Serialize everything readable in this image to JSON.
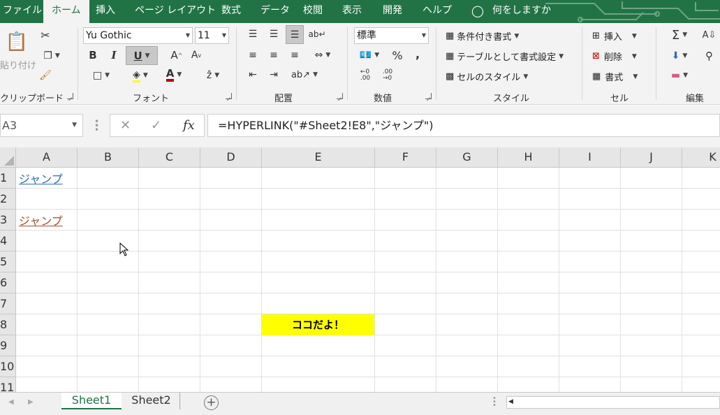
{
  "menu": {
    "tabs": [
      "ファイル",
      "ホーム",
      "挿入",
      "ページ レイアウト",
      "数式",
      "データ",
      "校閲",
      "表示",
      "開発",
      "ヘルプ"
    ],
    "active_tab": "ホーム",
    "tell_me": "何をしますか"
  },
  "ribbon": {
    "clipboard": {
      "paste_label": "貼り付け",
      "group_label": "クリップボード"
    },
    "font": {
      "font_name": "Yu Gothic",
      "font_size": "11",
      "bold": "B",
      "italic": "I",
      "underline": "U",
      "grow": "A",
      "shrink": "A",
      "font_color_letter": "A",
      "group_label": "フォント"
    },
    "alignment": {
      "group_label": "配置"
    },
    "number": {
      "format": "標準",
      "percent": "%",
      "comma": ",",
      "group_label": "数値"
    },
    "styles": {
      "conditional": "条件付き書式",
      "as_table": "テーブルとして書式設定",
      "cell_styles": "セルのスタイル",
      "group_label": "スタイル"
    },
    "cells": {
      "insert": "挿入",
      "delete": "削除",
      "format": "書式",
      "group_label": "セル"
    },
    "editing": {
      "group_label": "編集"
    }
  },
  "formula_bar": {
    "name_box": "A3",
    "fx": "fx",
    "formula": "=HYPERLINK(\"#Sheet2!E8\",\"ジャンプ\")"
  },
  "grid": {
    "columns": [
      "A",
      "B",
      "C",
      "D",
      "E",
      "F",
      "G",
      "H",
      "I",
      "J",
      "K"
    ],
    "rows": [
      "1",
      "2",
      "3",
      "4",
      "5",
      "6",
      "7",
      "8",
      "9",
      "10",
      "11"
    ],
    "cells": {
      "A1": "ジャンプ",
      "A3": "ジャンプ",
      "E8": "ココだよ！"
    }
  },
  "sheets": {
    "tabs": [
      "Sheet1",
      "Sheet2"
    ],
    "active": "Sheet1"
  },
  "colors": {
    "excel_green": "#217346",
    "link_blue": "#2f6fb0",
    "visited_link": "#a0522d",
    "highlight_yellow": "#ffff00"
  }
}
